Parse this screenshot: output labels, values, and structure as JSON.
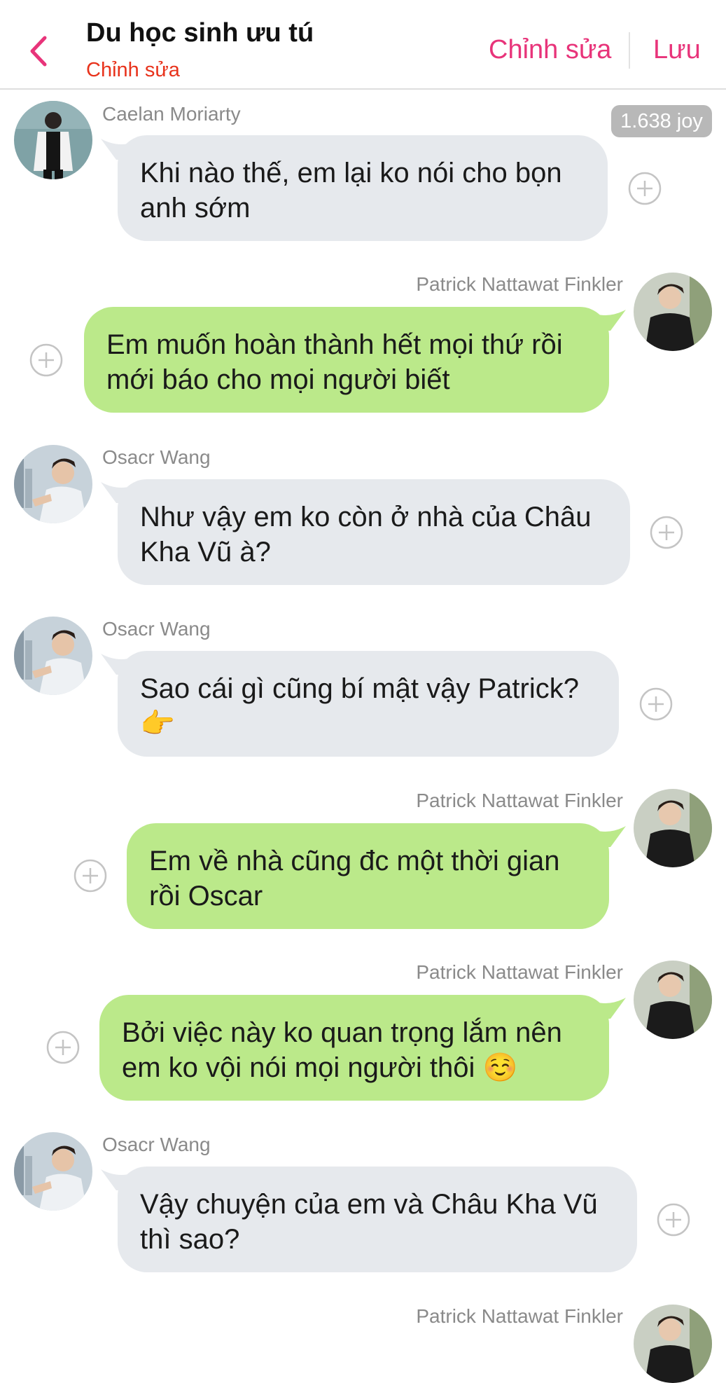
{
  "header": {
    "title": "Du học sinh ưu tú",
    "subtitle": "Chỉnh sửa",
    "edit_label": "Chỉnh sửa",
    "save_label": "Lưu"
  },
  "badge": "1.638 joy",
  "messages": [
    {
      "sender": "Caelan Moriarty",
      "side": "left",
      "text_lines": [
        "Khi nào thế, em lại ko nói cho bọn",
        "anh sớm"
      ]
    },
    {
      "sender": "Patrick Nattawat Finkler",
      "side": "right",
      "text_lines": [
        "Em muốn hoàn thành hết mọi thứ rồi",
        "mới báo cho mọi người biết"
      ]
    },
    {
      "sender": "Osacr Wang",
      "side": "left",
      "text_lines": [
        "Như vậy em ko còn ở nhà của Châu",
        "Kha Vũ à?"
      ]
    },
    {
      "sender": "Osacr Wang",
      "side": "left",
      "text_lines": [
        "Sao cái gì cũng bí mật vậy Patrick?",
        "👉"
      ]
    },
    {
      "sender": "Patrick Nattawat Finkler",
      "side": "right",
      "text_lines": [
        "Em về nhà cũng đc một thời gian",
        "rồi Oscar"
      ]
    },
    {
      "sender": "Patrick Nattawat Finkler",
      "side": "right",
      "text_lines": [
        "Bởi việc này ko quan trọng lắm nên",
        "em ko vội nói mọi người thôi ☺️"
      ]
    },
    {
      "sender": "Osacr Wang",
      "side": "left",
      "text_lines": [
        "Vậy chuyện của em và Châu Kha Vũ",
        "thì sao?"
      ]
    },
    {
      "sender": "Patrick Nattawat Finkler",
      "side": "right",
      "text_lines": []
    }
  ],
  "colors": {
    "accent": "#e8347a",
    "subtitle": "#e8331c",
    "bubble_left": "#e6e9ed",
    "bubble_right": "#bbe98a",
    "name_gray": "#8a8a8a"
  },
  "icons": {
    "back": "chevron-left-icon",
    "add": "plus-circle-icon"
  }
}
